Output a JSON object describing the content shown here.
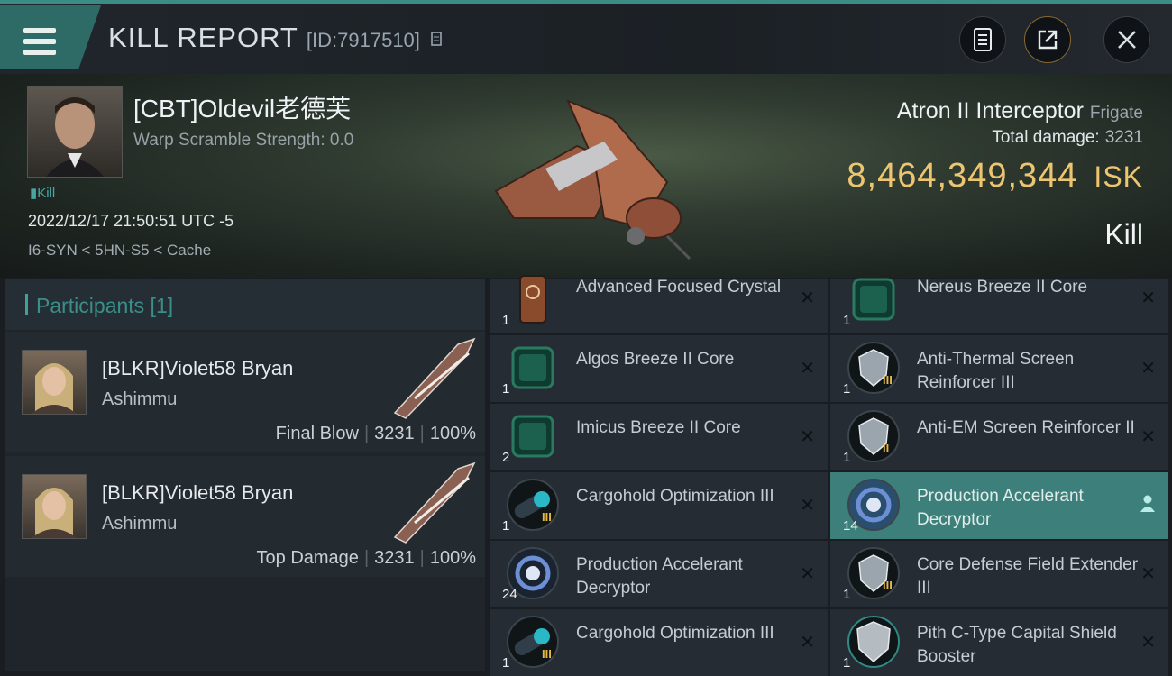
{
  "header": {
    "title": "KILL REPORT",
    "report_id": "[ID:7917510]"
  },
  "victim": {
    "name": "[CBT]Oldevil老德芙",
    "warp_scramble": "Warp Scramble Strength: 0.0",
    "kill_tag": "Kill",
    "datetime": "2022/12/17 21:50:51 UTC -5",
    "location": "I6-SYN < 5HN-S5 < Cache",
    "ship_name": "Atron II Interceptor",
    "ship_class": "Frigate",
    "total_damage_label": "Total damage:",
    "total_damage_value": "3231",
    "isk_value": "8,464,349,344",
    "isk_unit": "ISK",
    "kill_type": "Kill"
  },
  "participants": {
    "header": "Participants [1]",
    "rows": [
      {
        "name": "[BLKR]Violet58 Bryan",
        "ship": "Ashimmu",
        "role": "Final Blow",
        "damage": "3231",
        "percent": "100%"
      },
      {
        "name": "[BLKR]Violet58 Bryan",
        "ship": "Ashimmu",
        "role": "Top Damage",
        "damage": "3231",
        "percent": "100%"
      }
    ]
  },
  "items_left": [
    {
      "name": "Advanced Focused Crystal",
      "qty": "1",
      "icon": "crystal-icon",
      "color": "#8a4b2d"
    },
    {
      "name": "Algos Breeze II Core",
      "qty": "1",
      "icon": "core-icon",
      "color": "#2a7a62"
    },
    {
      "name": "Imicus Breeze II Core",
      "qty": "2",
      "icon": "core-icon",
      "color": "#2a7a62"
    },
    {
      "name": "Cargohold Optimization III",
      "qty": "1",
      "icon": "rig-icon",
      "color": "#2ab7c6",
      "tier": "III"
    },
    {
      "name": "Production Accelerant Decryptor",
      "qty": "24",
      "icon": "decryptor-icon",
      "color": "#6d8fd6"
    },
    {
      "name": "Cargohold Optimization III",
      "qty": "1",
      "icon": "rig-icon",
      "color": "#2ab7c6",
      "tier": "III"
    }
  ],
  "items_right": [
    {
      "name": "Nereus Breeze II Core",
      "qty": "1",
      "icon": "core-icon",
      "color": "#2a7a62"
    },
    {
      "name": "Anti-Thermal Screen Reinforcer III",
      "qty": "1",
      "icon": "shield-rig-icon",
      "color": "#9aa5ad",
      "tier": "III"
    },
    {
      "name": "Anti-EM Screen Reinforcer II",
      "qty": "1",
      "icon": "shield-rig-icon",
      "color": "#9aa5ad",
      "tier": "II"
    },
    {
      "name": "Production Accelerant Decryptor",
      "qty": "14",
      "icon": "decryptor-icon",
      "color": "#6d8fd6",
      "highlight": true
    },
    {
      "name": "Core Defense Field Extender III",
      "qty": "1",
      "icon": "shield-rig-icon",
      "color": "#9aa5ad",
      "tier": "III"
    },
    {
      "name": "Pith C-Type Capital Shield Booster",
      "qty": "1",
      "icon": "shield-booster-icon",
      "color": "#b5bcc1"
    }
  ]
}
